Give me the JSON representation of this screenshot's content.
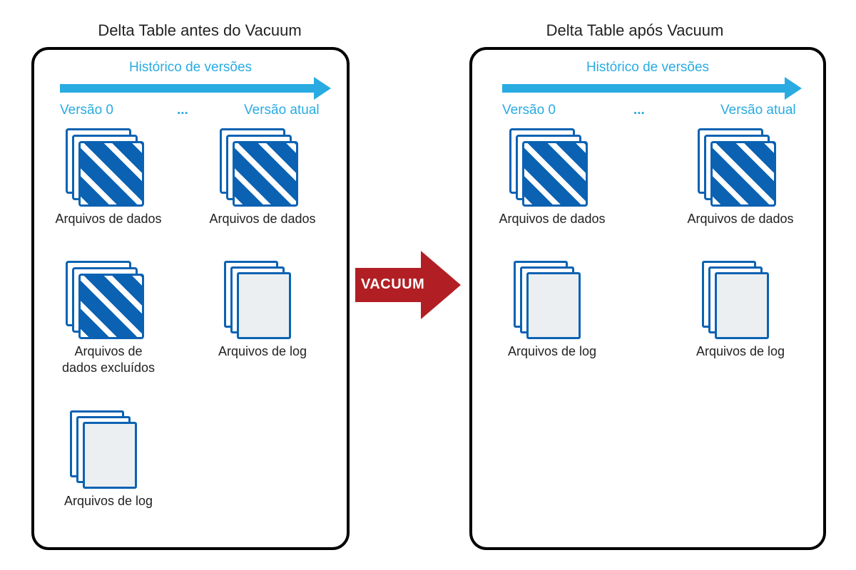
{
  "colors": {
    "arrow": "#29abe2",
    "vacuum": "#b11f24"
  },
  "before": {
    "title": "Delta Table antes do Vacuum",
    "history_label": "Histórico de versões",
    "version_start": "Versão 0",
    "ellipsis": "...",
    "version_end": "Versão atual",
    "cells": [
      {
        "id": "v0-data",
        "label": "Arquivos de dados"
      },
      {
        "id": "cur-data",
        "label": "Arquivos de dados"
      },
      {
        "id": "v0-deleted",
        "label": "Arquivos de\ndados excluídos"
      },
      {
        "id": "cur-log",
        "label": "Arquivos de log"
      },
      {
        "id": "v0-log",
        "label": "Arquivos de log"
      }
    ]
  },
  "vacuum_label": "VACUUM",
  "after": {
    "title": "Delta Table após Vacuum",
    "history_label": "Histórico de versões",
    "version_start": "Versão 0",
    "ellipsis": "...",
    "version_end": "Versão atual",
    "cells": [
      {
        "id": "v0-data",
        "label": "Arquivos de dados"
      },
      {
        "id": "cur-data",
        "label": "Arquivos de dados"
      },
      {
        "id": "v0-log",
        "label": "Arquivos de log"
      },
      {
        "id": "cur-log",
        "label": "Arquivos de log"
      }
    ]
  }
}
